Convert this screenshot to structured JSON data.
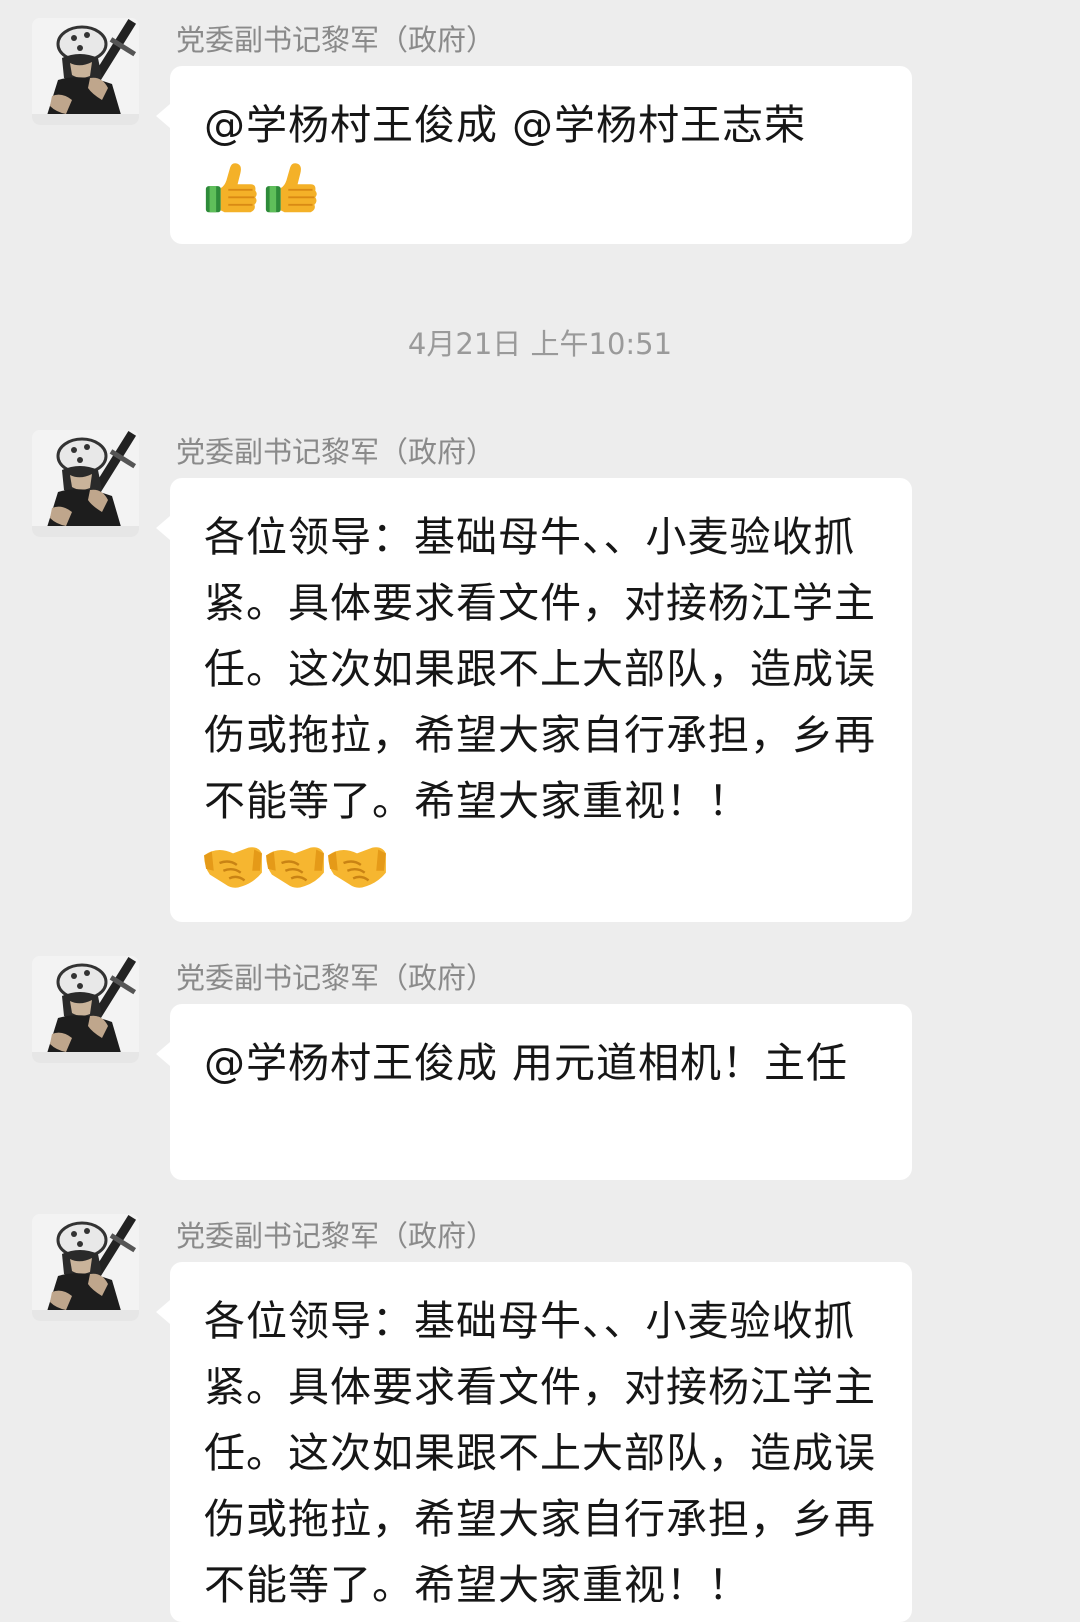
{
  "messages": [
    {
      "sender": "党委副书记黎军（政府）",
      "text": "@学杨村王俊成 @学杨村王志荣",
      "emojis": [
        "thumbs-up",
        "thumbs-up"
      ]
    },
    {
      "sender": "党委副书记黎军（政府）",
      "text": "各位领导：基础母牛、、小麦验收抓紧。具体要求看文件，对接杨江学主任。这次如果跟不上大部队，造成误伤或拖拉，希望大家自行承担，乡再不能等了。希望大家重视！！",
      "emojis": [
        "handshake",
        "handshake",
        "handshake"
      ]
    },
    {
      "sender": "党委副书记黎军（政府）",
      "text": "@学杨村王俊成  用元道相机！主任",
      "emojis": []
    },
    {
      "sender": "党委副书记黎军（政府）",
      "text": "各位领导：基础母牛、、小麦验收抓紧。具体要求看文件，对接杨江学主任。这次如果跟不上大部队，造成误伤或拖拉，希望大家自行承担，乡再不能等了。希望大家重视！！",
      "emojis": []
    }
  ],
  "timestamp": "4月21日 上午10:51",
  "colors": {
    "background": "#ededed",
    "bubble": "#ffffff",
    "sender_text": "#8a8a8a",
    "message_text": "#161616"
  }
}
